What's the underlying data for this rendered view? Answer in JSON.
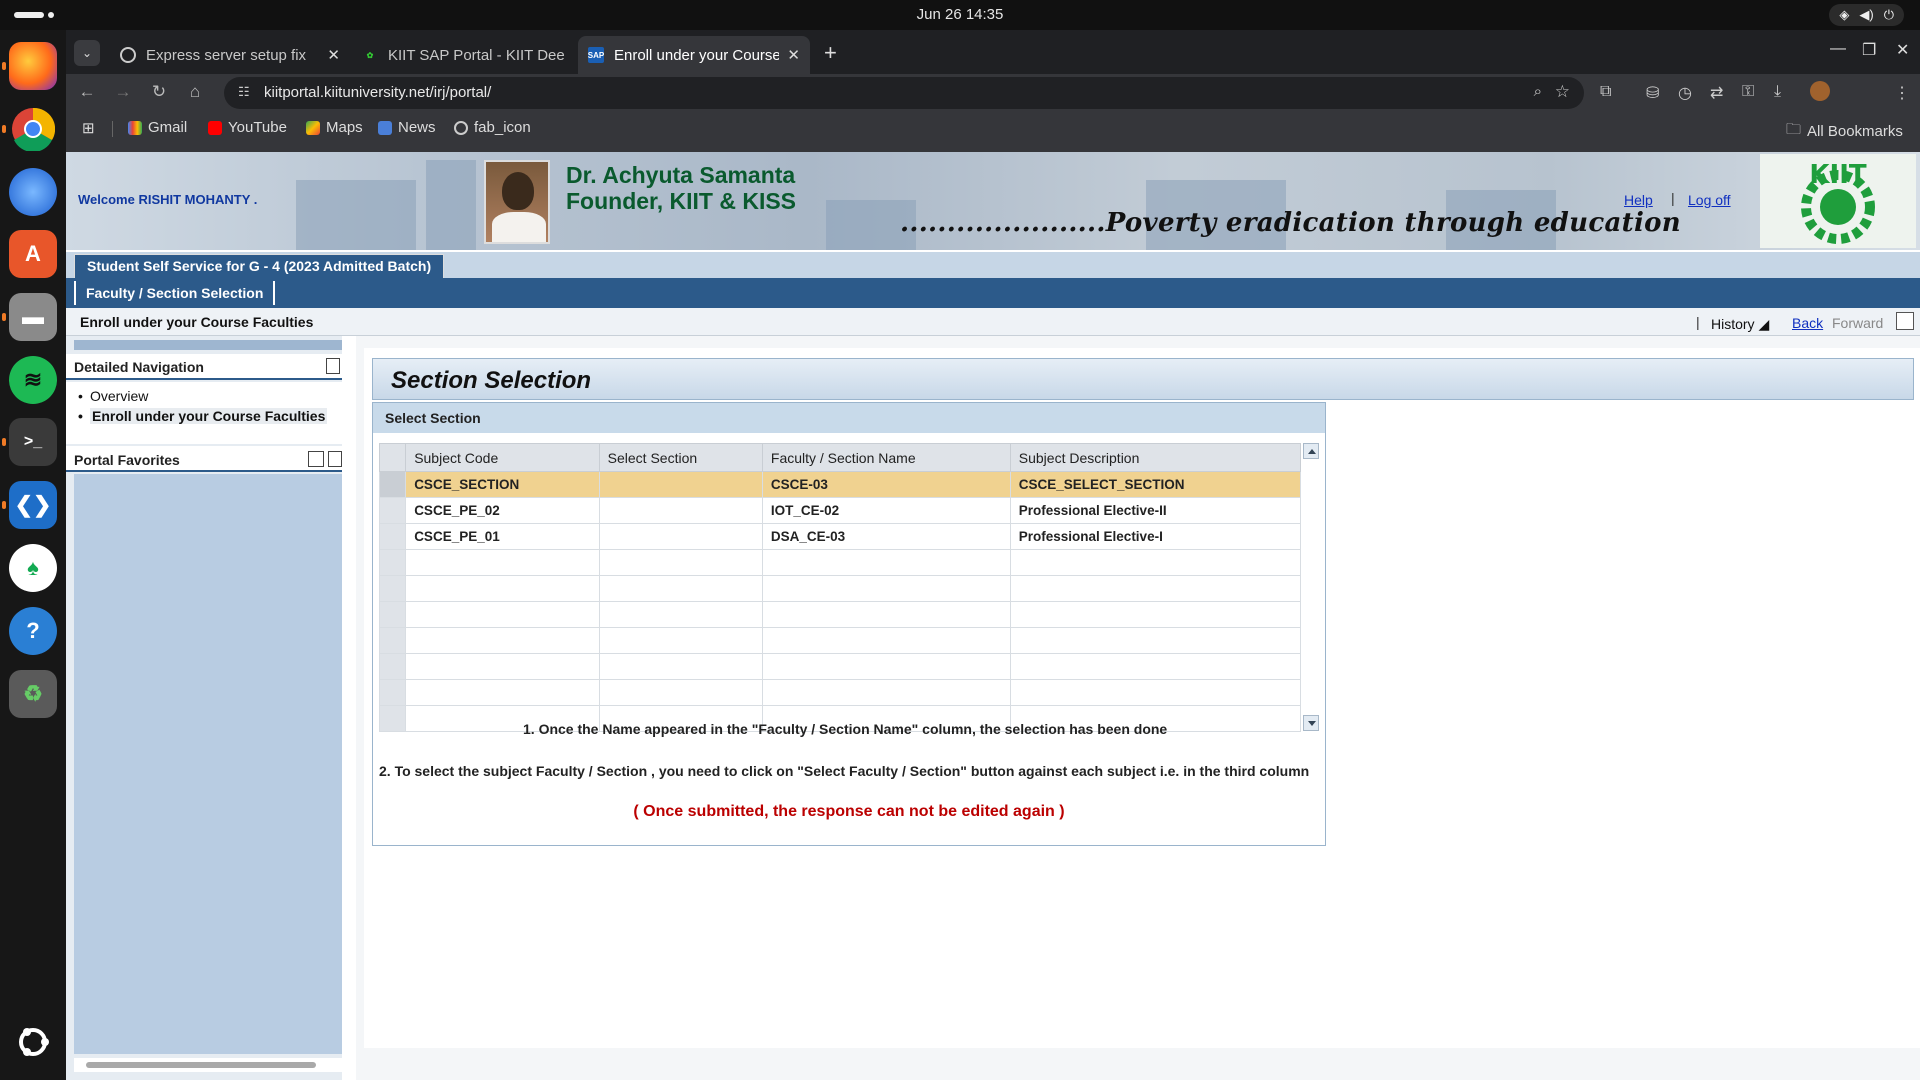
{
  "topbar": {
    "clock": "Jun 26  14:35"
  },
  "dock": {
    "apps": [
      {
        "name": "Firefox",
        "icon": "firefox-icon"
      },
      {
        "name": "Chrome",
        "icon": "chrome-icon"
      },
      {
        "name": "Thunderbird",
        "icon": "thunderbird-icon"
      },
      {
        "name": "App Center",
        "icon": "app-center-icon"
      },
      {
        "name": "Files",
        "icon": "files-icon"
      },
      {
        "name": "Spotify",
        "icon": "spotify-icon"
      },
      {
        "name": "Terminal",
        "icon": "terminal-icon"
      },
      {
        "name": "VS Code",
        "icon": "vscode-icon"
      },
      {
        "name": "MongoDB Compass",
        "icon": "mongodb-icon"
      },
      {
        "name": "Help",
        "icon": "help-icon"
      },
      {
        "name": "Trash",
        "icon": "trash-icon"
      },
      {
        "name": "Show Apps",
        "icon": "ubuntu-icon"
      }
    ]
  },
  "browser": {
    "tabs": [
      {
        "title": "Express server setup fix"
      },
      {
        "title": "KIIT SAP Portal - KIIT Dee"
      },
      {
        "title": "Enroll under your Course"
      }
    ],
    "url": "kiitportal.kiituniversity.net/irj/portal/",
    "bookmarks": [
      "Gmail",
      "YouTube",
      "Maps",
      "News",
      "fab_icon"
    ],
    "all_bookmarks": "All Bookmarks"
  },
  "portal": {
    "welcome": "Welcome RISHIT MOHANTY .",
    "founder_name": "Dr. Achyuta Samanta",
    "founder_title": "Founder, KIIT & KISS",
    "motto": "......................Poverty eradication through education",
    "help": "Help",
    "logoff": "Log off",
    "logo_text": "KIIT",
    "level1_tab": "Student Self Service for G - 4 (2023 Admitted Batch)",
    "level2_tab": "Faculty / Section Selection",
    "page_title": "Enroll under your Course Faculties",
    "history": "History",
    "back": "Back",
    "forward": "Forward",
    "nav": {
      "heading": "Detailed Navigation",
      "items": [
        "Overview",
        "Enroll under your Course Faculties"
      ],
      "favorites": "Portal Favorites"
    },
    "section": {
      "title": "Section Selection",
      "group_title": "Select Section",
      "columns": [
        "Subject Code",
        "Select Section",
        "Faculty / Section Name",
        "Subject Description"
      ],
      "rows": [
        [
          "CSCE_SECTION",
          "",
          "CSCE-03",
          "CSCE_SELECT_SECTION"
        ],
        [
          "CSCE_PE_02",
          "",
          "IOT_CE-02",
          "Professional Elective-II"
        ],
        [
          "CSCE_PE_01",
          "",
          "DSA_CE-03",
          "Professional Elective-I"
        ],
        [
          "",
          "",
          "",
          ""
        ],
        [
          "",
          "",
          "",
          ""
        ],
        [
          "",
          "",
          "",
          ""
        ],
        [
          "",
          "",
          "",
          ""
        ],
        [
          "",
          "",
          "",
          ""
        ],
        [
          "",
          "",
          "",
          ""
        ],
        [
          "",
          "",
          "",
          ""
        ]
      ],
      "note1": "1. Once the Name appeared in the \"Faculty / Section Name\" column, the selection has been done",
      "note2": "2. To select the subject Faculty / Section , you need to click on \"Select Faculty / Section\" button against each subject i.e. in the third column",
      "note3": "( Once submitted, the response can not be edited again )"
    }
  }
}
